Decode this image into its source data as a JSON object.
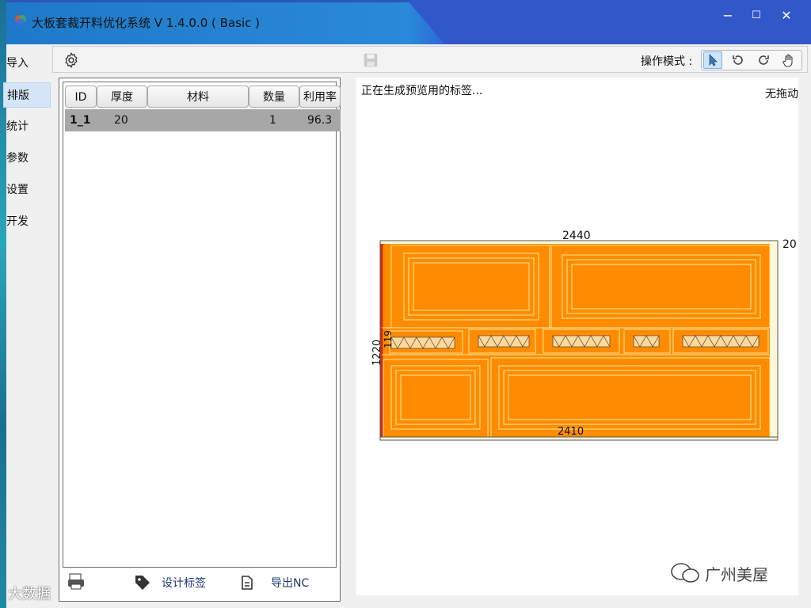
{
  "window": {
    "title": "大板套裁开料优化系统  V 1.4.0.0 ( Basic )",
    "controls": {
      "minimize": "−",
      "maximize": "☐",
      "close": "✕"
    }
  },
  "nav": {
    "items": [
      {
        "label": "导入"
      },
      {
        "label": "排版"
      },
      {
        "label": "统计"
      },
      {
        "label": "参数"
      },
      {
        "label": "设置"
      },
      {
        "label": "开发"
      }
    ],
    "active_index": 1
  },
  "toolbar": {
    "settings_icon": "gear-icon",
    "save_icon": "save-icon",
    "mode_label": "操作模式 :",
    "modes": [
      "cursor-icon",
      "rotate-ccw-icon",
      "rotate-cw-icon",
      "hand-icon"
    ],
    "selected_mode": 0
  },
  "table": {
    "columns": [
      "ID",
      "厚度",
      "材料",
      "数量",
      "利用率"
    ],
    "rows": [
      {
        "id": "1_1",
        "thickness": "20",
        "material": "",
        "qty": "1",
        "utilization": "96.3"
      }
    ]
  },
  "bottom": {
    "design_label": "设计标签",
    "export_label": "导出NC"
  },
  "preview": {
    "status": "正在生成预览用的标签...",
    "drag_mode": "无拖动",
    "board": {
      "width_label": "2440",
      "height_label": "1220",
      "thickness_label": "20",
      "inner_width_label": "2410",
      "strip_label": "119",
      "fill_color": "#ff8c00",
      "line_color": "#ffe79a"
    }
  },
  "watermarks": {
    "right": "广州美屋",
    "left": "大数据"
  },
  "colors": {
    "titlebar": "#2b57b6",
    "nav_active": "#d3e5f7",
    "row_selected": "#a7a7a7"
  }
}
